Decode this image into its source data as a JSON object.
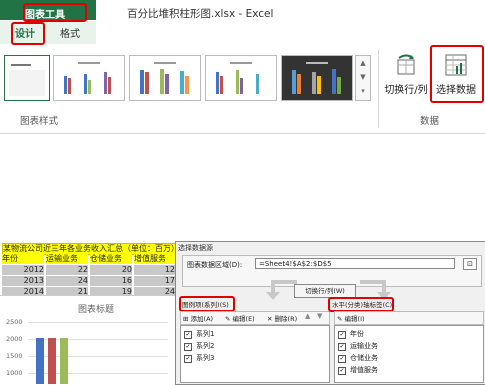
{
  "ribbon": {
    "tool_group_title": "图表工具",
    "tabs": [
      "设计",
      "格式"
    ],
    "window_title": "百分比堆积柱形图.xlsx - Excel",
    "styles_group_label": "图表样式",
    "data_group_label": "数据",
    "switch_row_col_label": "切换行/列",
    "select_data_label": "选择数据"
  },
  "sheet": {
    "table_title": "某物流公司近三年各业务收入汇总（单位：百万）",
    "headers": [
      "年份",
      "运输业务",
      "仓储业务",
      "增值服务"
    ],
    "rows": [
      [
        "2012",
        "22",
        "20",
        "12"
      ],
      [
        "2013",
        "24",
        "16",
        "17"
      ],
      [
        "2014",
        "21",
        "19",
        "24"
      ]
    ]
  },
  "chart": {
    "title": "图表标题",
    "y_ticks": [
      "2500",
      "2000",
      "1500",
      "1000"
    ]
  },
  "dialog": {
    "title": "选择数据源",
    "range_label": "图表数据区域(D):",
    "range_value": "=Sheet4!$A$2:$D$5",
    "switch_button": "切换行/列(W)",
    "legend_label": "图例项(系列)(S)",
    "axis_label": "水平(分类)轴标签(C)",
    "add_label": "添加(A)",
    "edit_label": "编辑(E)",
    "delete_label": "删除(R)",
    "axis_edit_label": "编辑(I)",
    "series": [
      "系列1",
      "系列2",
      "系列3"
    ],
    "categories": [
      "年份",
      "运输业务",
      "仓储业务",
      "增值服务"
    ]
  },
  "colors": {
    "excel_green": "#217346",
    "highlight_red": "#e00000",
    "series_blue": "#4472c4",
    "series_red": "#c0504d",
    "series_green": "#9bbb59"
  }
}
